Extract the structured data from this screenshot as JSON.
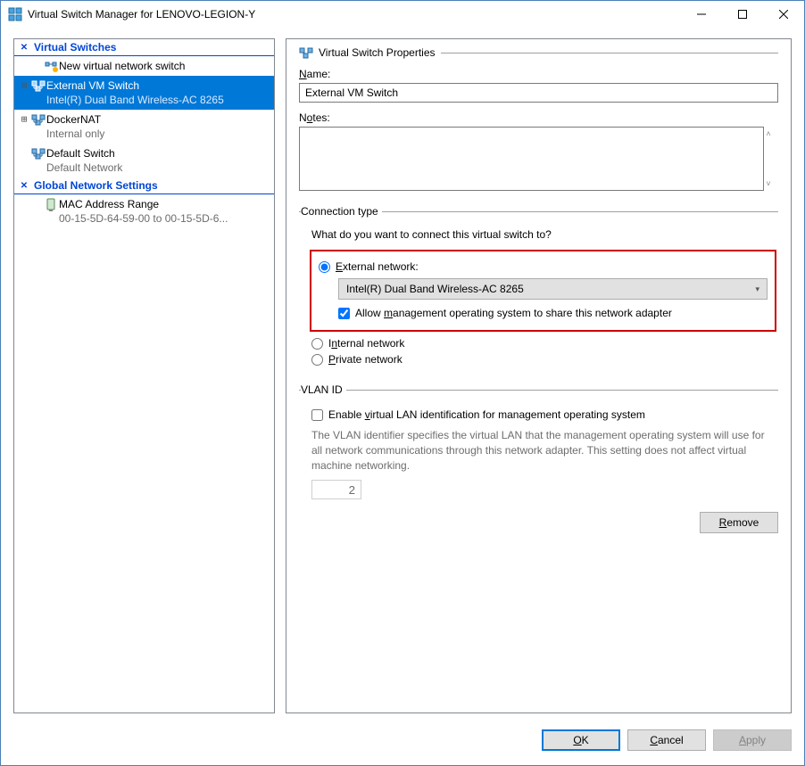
{
  "window": {
    "title": "Virtual Switch Manager for LENOVO-LEGION-Y"
  },
  "sidebar": {
    "section_switches": "Virtual Switches",
    "new_switch": "New virtual network switch",
    "items": [
      {
        "name": "External VM Switch",
        "sub": "Intel(R) Dual Band Wireless-AC 8265"
      },
      {
        "name": "DockerNAT",
        "sub": "Internal only"
      },
      {
        "name": "Default Switch",
        "sub": "Default Network"
      }
    ],
    "section_global": "Global Network Settings",
    "mac_label": "MAC Address Range",
    "mac_range": "00-15-5D-64-59-00 to 00-15-5D-6..."
  },
  "props": {
    "header": "Virtual Switch Properties",
    "name_label": "Name:",
    "name_value": "External VM Switch",
    "notes_label": "Notes:",
    "notes_value": "",
    "conn_legend": "Connection type",
    "conn_q": "What do you want to connect this virtual switch to?",
    "radio_external": "External network:",
    "adapter": "Intel(R) Dual Band Wireless-AC 8265",
    "allow_mgmt_pre": "Allow ",
    "allow_mgmt_u": "m",
    "allow_mgmt_post": "anagement operating system to share this network adapter",
    "radio_internal": "Internal network",
    "radio_private": "Private network",
    "vlan_legend": "VLAN ID",
    "vlan_enable_pre": "Enable ",
    "vlan_enable_u": "v",
    "vlan_enable_post": "irtual LAN identification for management operating system",
    "vlan_desc": "The VLAN identifier specifies the virtual LAN that the management operating system will use for all network communications through this network adapter. This setting does not affect virtual machine networking.",
    "vlan_value": "2",
    "remove_u": "R",
    "remove_post": "emove"
  },
  "footer": {
    "ok_u": "O",
    "ok_post": "K",
    "cancel_u": "C",
    "cancel_post": "ancel",
    "apply_u": "A",
    "apply_post": "pply"
  }
}
